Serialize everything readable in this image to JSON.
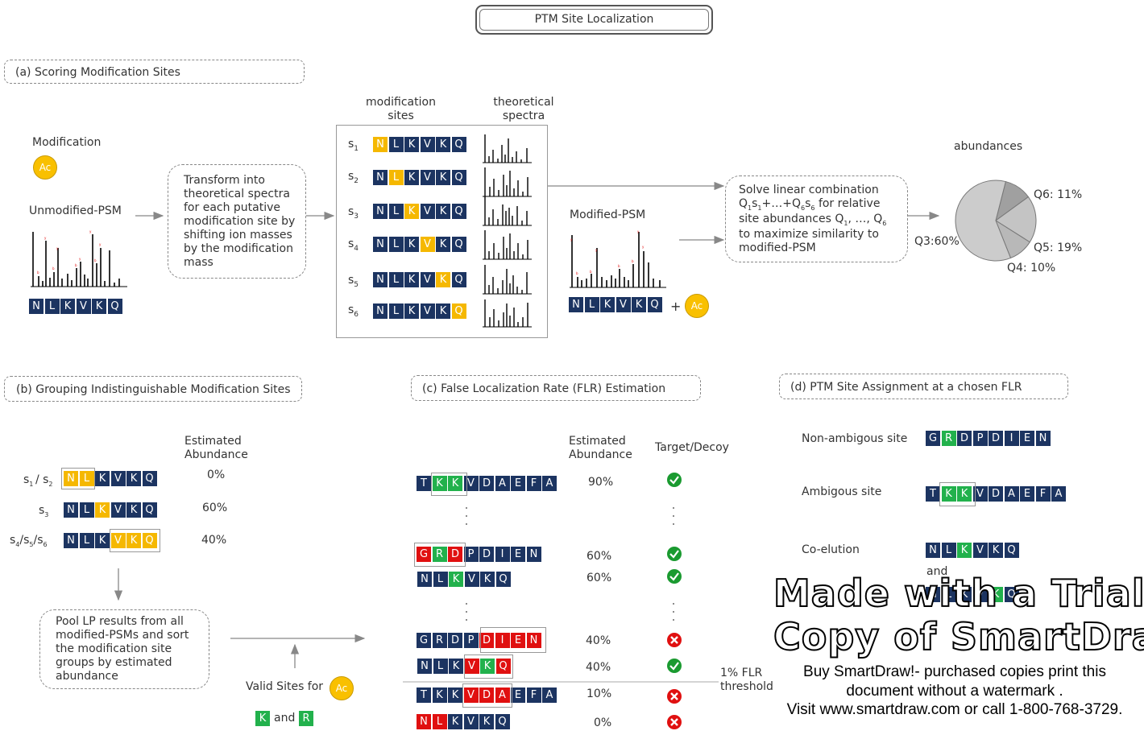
{
  "title": "PTM Site Localization",
  "sections": {
    "a": "(a) Scoring Modification Sites",
    "b": "(b) Grouping Indistinguishable Modification Sites",
    "c": "(c) False Localization Rate (FLR) Estimation",
    "d": "(d) PTM Site Assignment at a chosen FLR"
  },
  "panel_a": {
    "modification_label": "Modification",
    "ac": "Ac",
    "unmodified_label": "Unmodified-PSM",
    "peptide": [
      "N",
      "L",
      "K",
      "V",
      "K",
      "Q"
    ],
    "transform_text": "Transform into\ntheoretical spectra\nfor each putative\nmodification site by\nshifting ion masses\nby the modification\nmass",
    "col_mod_sites": "modification\nsites",
    "col_theo_spectra": "theoretical\nspectra",
    "sites": [
      "s",
      "s",
      "s",
      "s",
      "s",
      "s"
    ],
    "site_subs": [
      "1",
      "2",
      "3",
      "4",
      "5",
      "6"
    ],
    "modified_label": "Modified-PSM",
    "plus": "+",
    "solve_text_1": "Solve linear combination",
    "solve_text_2": "for relative",
    "solve_text_3": "site abundances Q",
    "solve_text_4": "to maximize similarity to",
    "solve_text_5": "modified-PSM",
    "abundances_label": "abundances",
    "pie_labels": [
      "Q6: 11%",
      "Q5: 19%",
      "Q4: 10%",
      "Q3:60%"
    ]
  },
  "panel_b": {
    "est_abundance": "Estimated\nAbundance",
    "rows": [
      {
        "label": "s1 / s2",
        "value": "0%"
      },
      {
        "label": "s3",
        "value": "60%"
      },
      {
        "label": "s4/s5/s6",
        "value": "40%"
      }
    ],
    "pool_text": "Pool LP results from all\nmodified-PSMs and sort\nthe modification site\ngroups by estimated\nabundance",
    "valid_sites": "Valid Sites for",
    "valid_ac": "Ac",
    "and": "and",
    "k": "K",
    "r": "R"
  },
  "panel_c": {
    "est_abundance": "Estimated\nAbundance",
    "target_decoy": "Target/Decoy",
    "values": [
      "90%",
      "60%",
      "60%",
      "40%",
      "40%",
      "10%",
      "0%"
    ],
    "flr": "1% FLR\nthreshold"
  },
  "panel_d": {
    "non_ambiguous": "Non-ambigous site",
    "ambiguous": "Ambigous site",
    "coelution": "Co-elution",
    "and": "and"
  },
  "watermark": {
    "line1": "Made with a Trial",
    "line2": "Copy of SmartDraw",
    "line3": "Buy SmartDraw!- purchased copies print this",
    "line4": "document without a watermark .",
    "line5": "Visit www.smartdraw.com or call 1-800-768-3729."
  },
  "colors": {
    "navy": "#1c3461",
    "yellow": "#f5b800",
    "green": "#22b14c",
    "red": "#e01010"
  },
  "icons": {
    "check": "check-circle-icon",
    "cross": "cross-circle-icon"
  },
  "chart_data": {
    "type": "pie",
    "title": "abundances",
    "categories": [
      "Q3",
      "Q4",
      "Q5",
      "Q6"
    ],
    "values": [
      60,
      10,
      19,
      11
    ]
  }
}
